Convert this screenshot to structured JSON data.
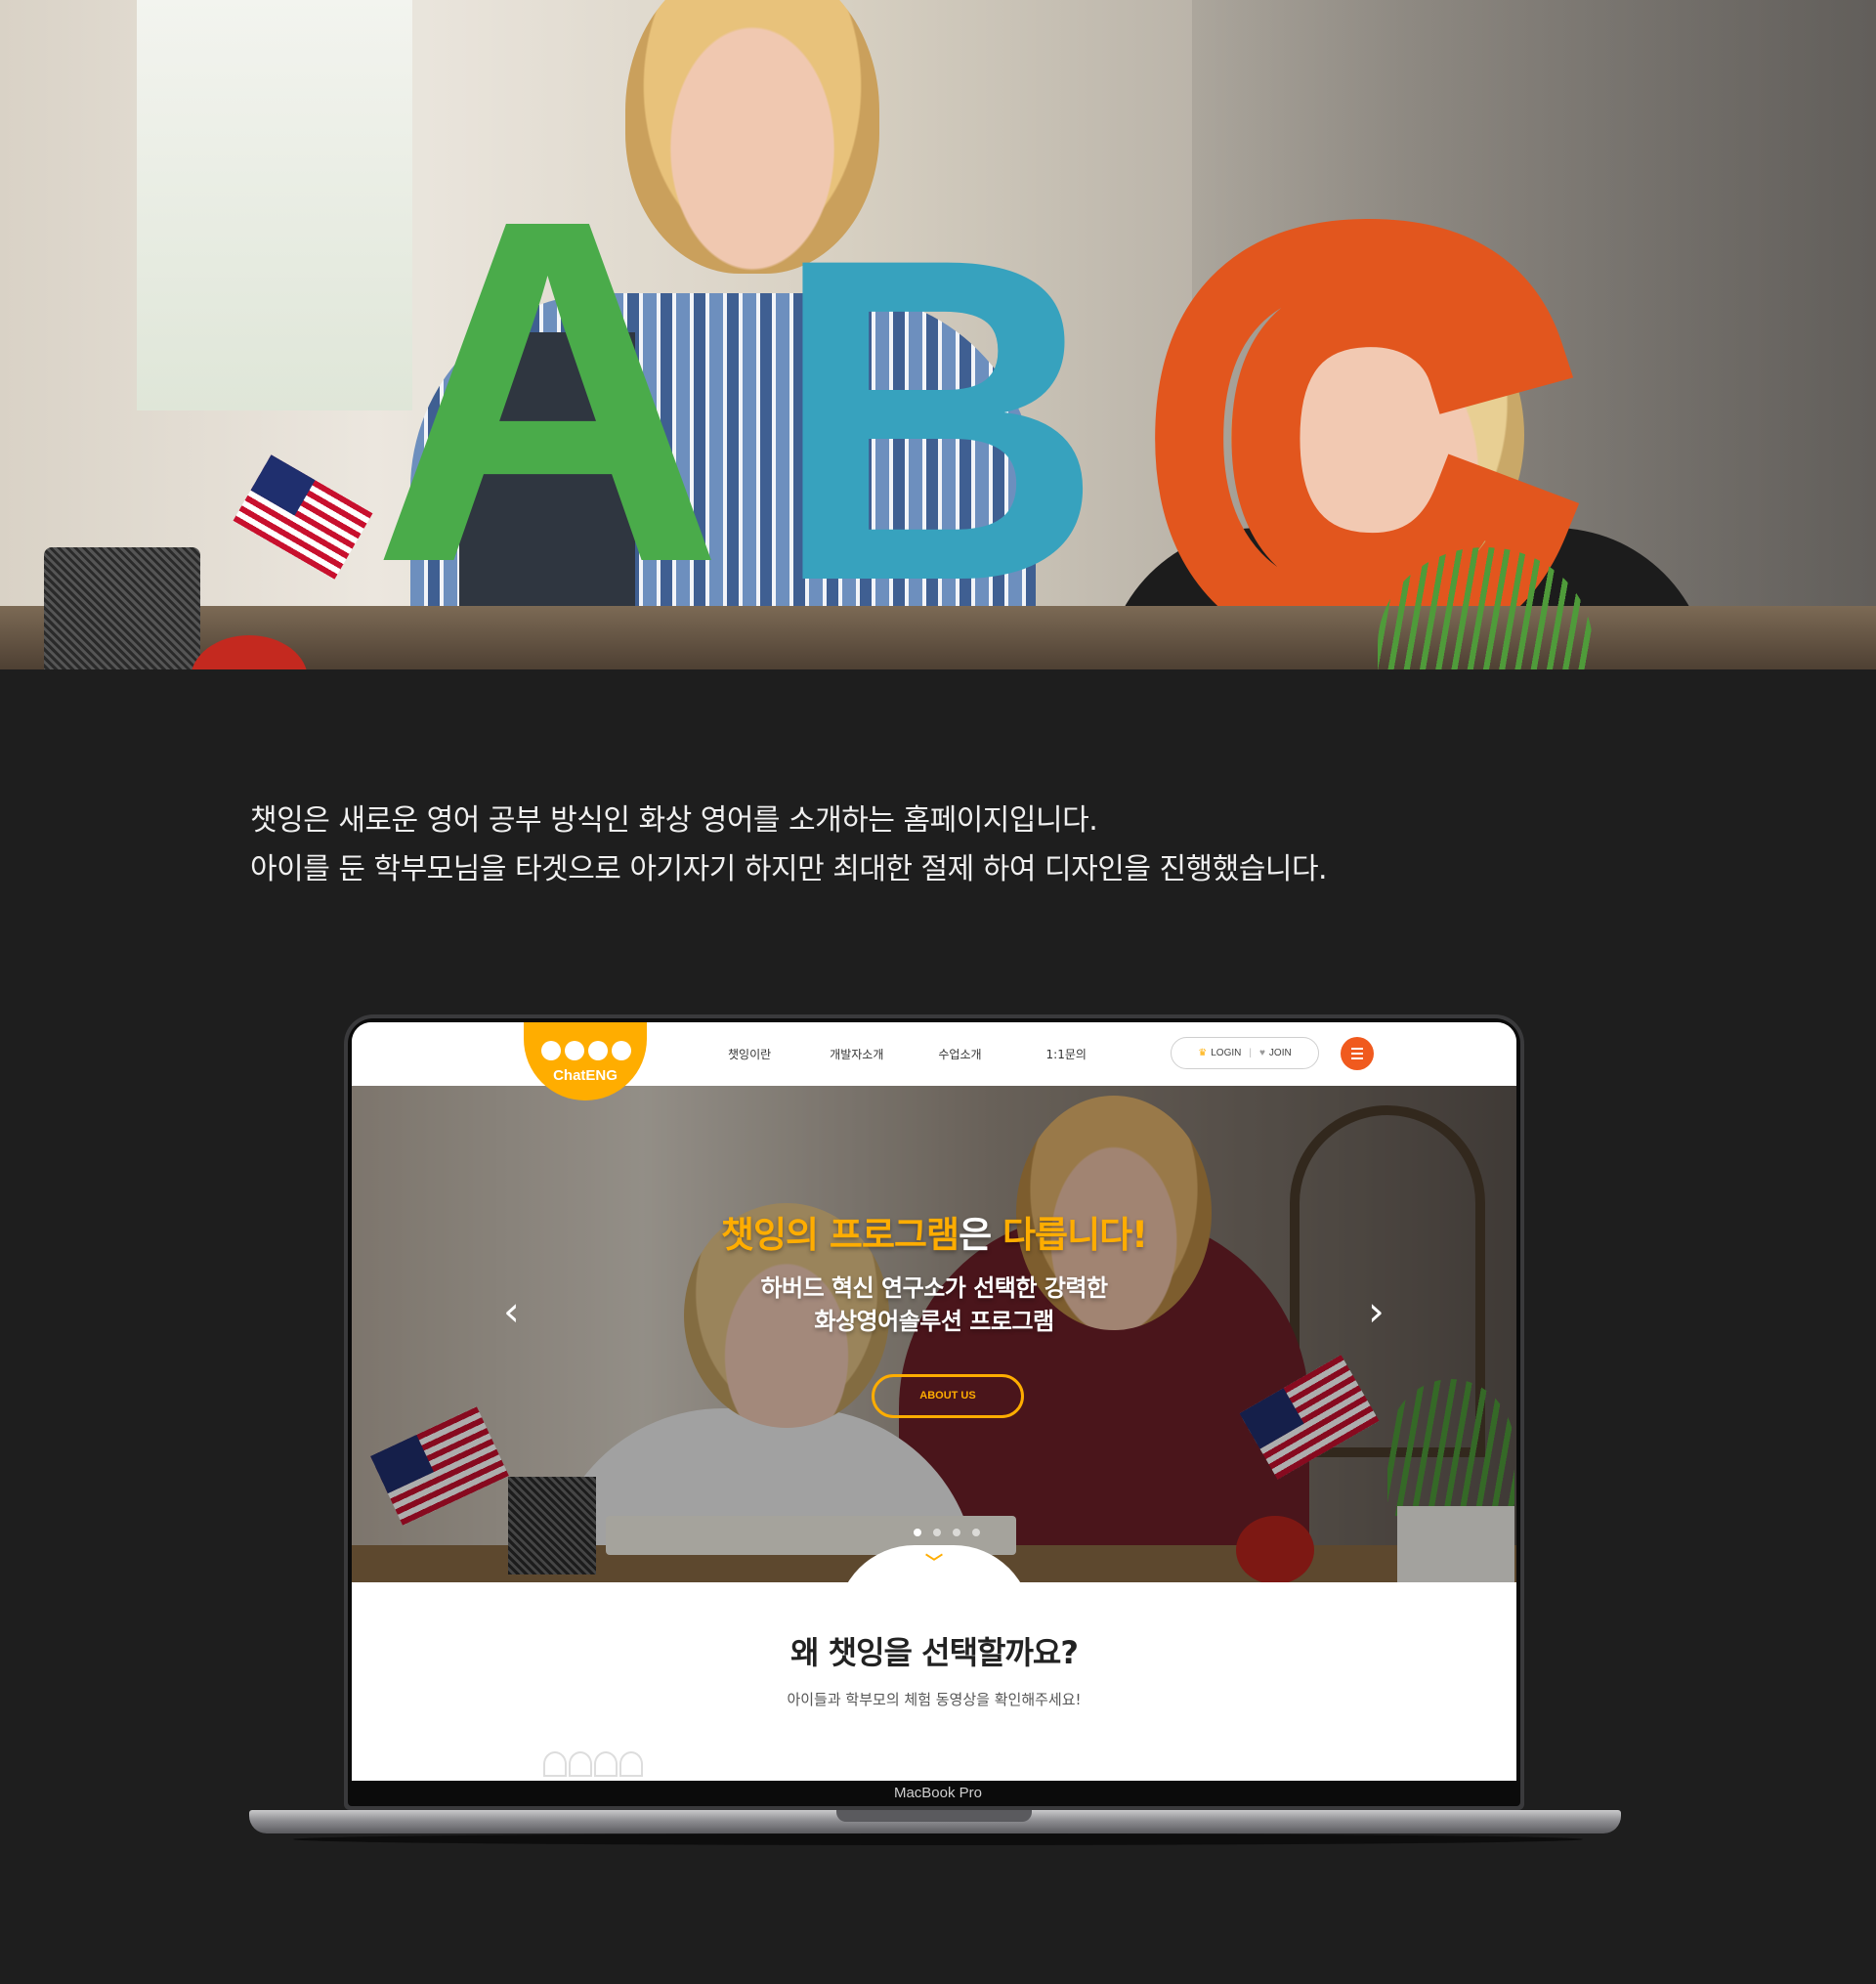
{
  "description": {
    "line1": "챗잉은 새로운 영어 공부 방식인 화상 영어를 소개하는 홈페이지입니다.",
    "line2": "아이를 둔 학부모님을 타겟으로 아기자기 하지만 최대한 절제 하여 디자인을 진행했습니다."
  },
  "hero_photo": {
    "letters": [
      "A",
      "B",
      "C"
    ]
  },
  "laptop": {
    "model_label": "MacBook Pro"
  },
  "site": {
    "logo_text": "ChatENG",
    "nav": {
      "items": [
        "챗잉이란",
        "개발자소개",
        "수업소개",
        "1:1문의"
      ],
      "login_label": "LOGIN",
      "join_label": "JOIN",
      "login_icon": "crown-icon",
      "join_icon": "heart-icon",
      "menu_icon": "hamburger-icon"
    },
    "slider": {
      "headline_part1": "챗잉의 프로그램",
      "headline_part2": "은 ",
      "headline_part3": "다릅니다!",
      "subline1": "하버드 혁신 연구소가 선택한 강력한",
      "subline2": "화상영어솔루션 프로그램",
      "button_label": "ABOUT US",
      "prev_arrow": "‹",
      "next_arrow": "›",
      "slide_count": 4,
      "active_slide": 1,
      "scroll_chevron": "﹀"
    },
    "section": {
      "title": "왜 챗잉을 선택할까요?",
      "subtitle": "아이들과 학부모의 체험 동영상을 확인해주세요!"
    },
    "colors": {
      "accent": "#ffad00",
      "menu_button": "#f05a1e",
      "page_background": "#1e1e1e"
    }
  }
}
